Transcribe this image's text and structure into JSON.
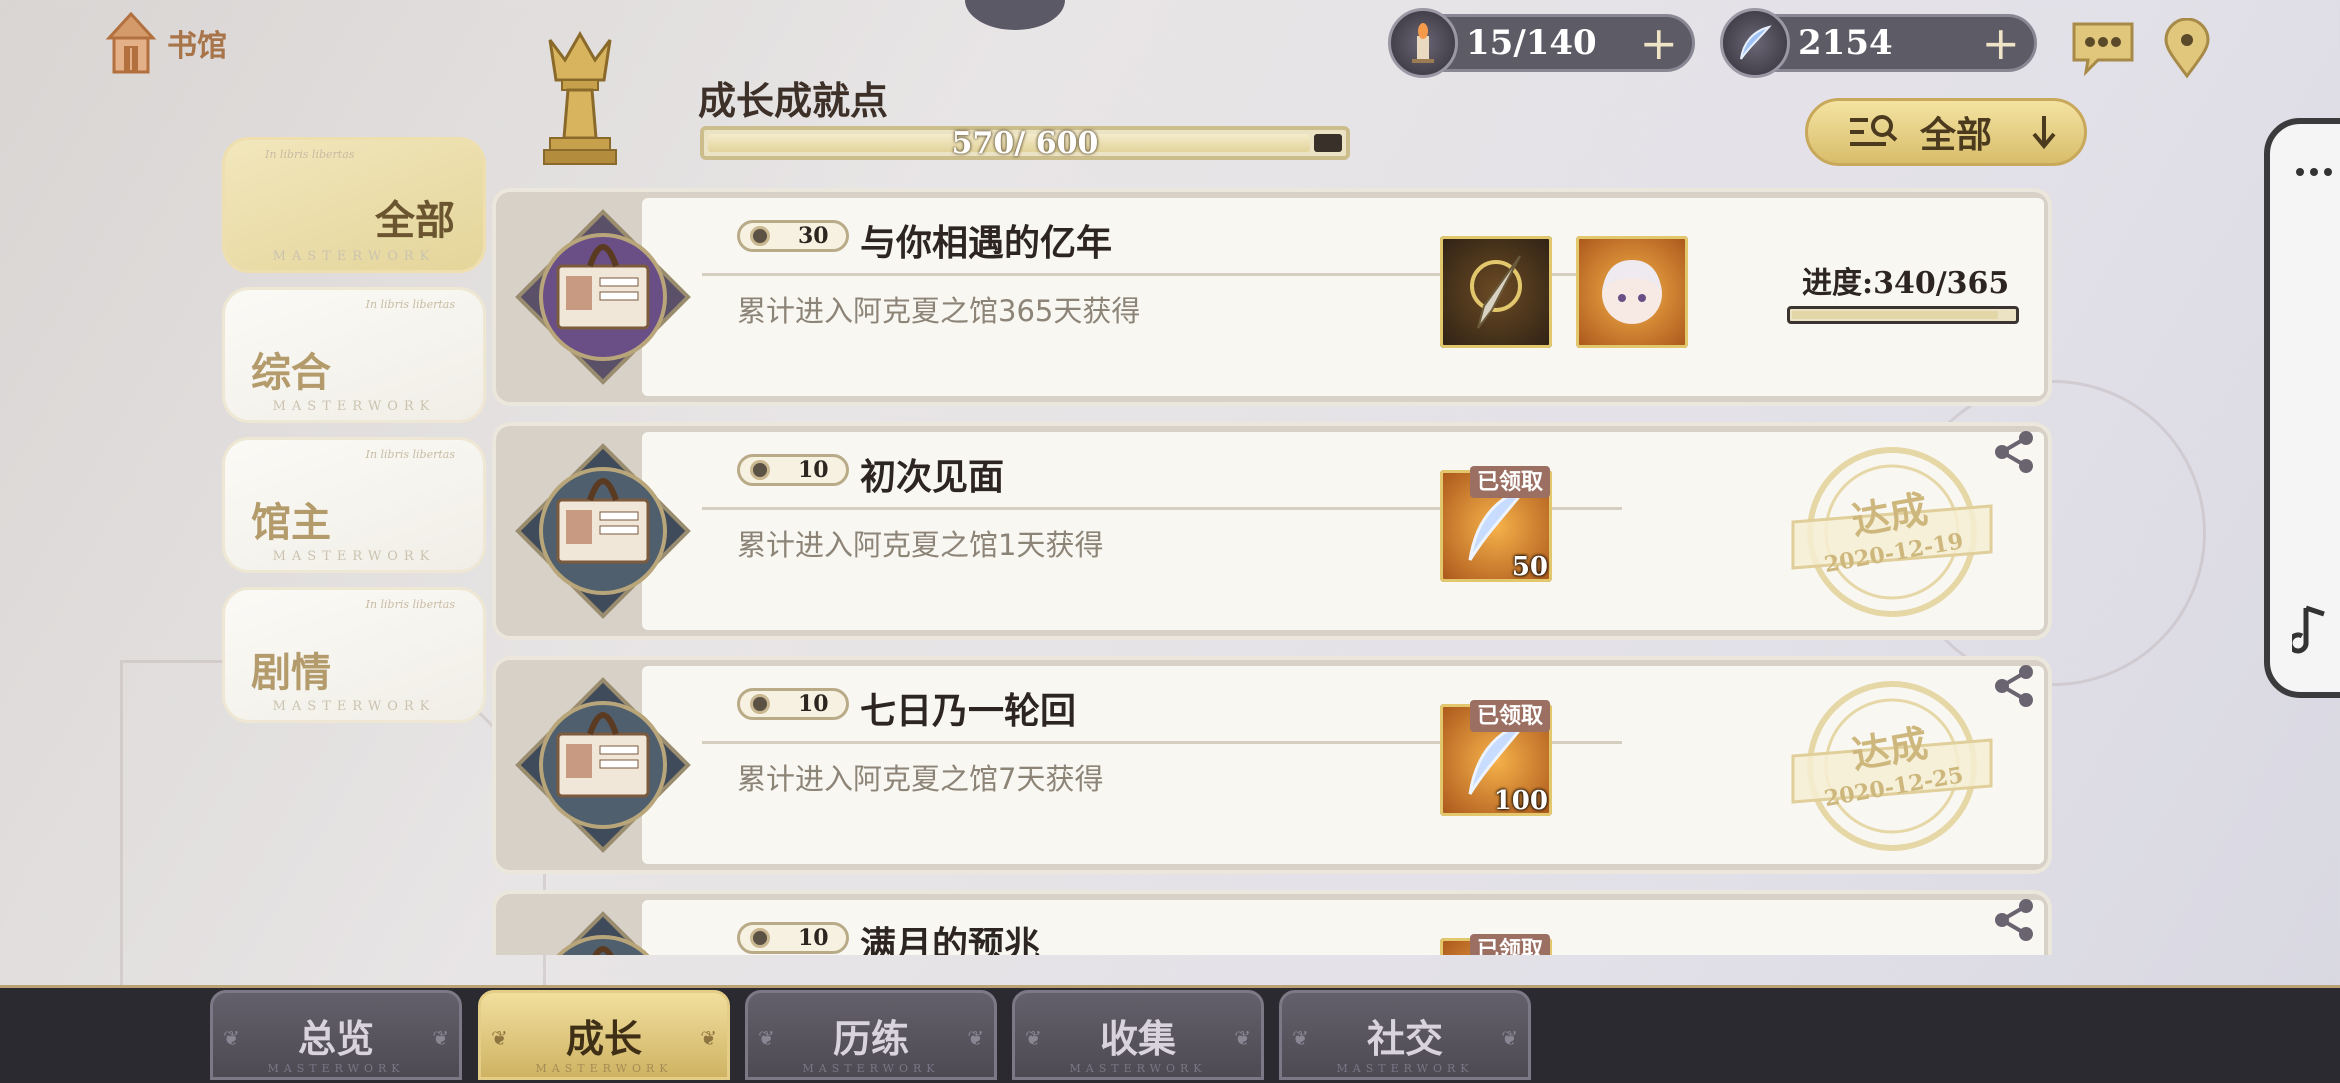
{
  "header": {
    "library_label": "书馆",
    "stamina_value": "15/140",
    "gem_value": "2154",
    "points_title": "成长成就点",
    "points_text": "570/ 600",
    "points_progress": 0.95,
    "filter_label": "全部"
  },
  "side_tabs": [
    {
      "label": "全部",
      "tiny": "In libris libertas",
      "mw": "MASTERWORK"
    },
    {
      "label": "综合",
      "tiny": "In libris libertas",
      "mw": "MASTERWORK"
    },
    {
      "label": "馆主",
      "tiny": "In libris libertas",
      "mw": "MASTERWORK"
    },
    {
      "label": "剧情",
      "tiny": "In libris libertas",
      "mw": "MASTERWORK"
    }
  ],
  "achievements": [
    {
      "points": "30",
      "title": "与你相遇的亿年",
      "desc": "累计进入阿克夏之馆365天获得",
      "progress_label": "进度:340/365",
      "progress": 0.93
    },
    {
      "points": "10",
      "title": "初次见面",
      "desc": "累计进入阿克夏之馆1天获得",
      "claimed": "已领取",
      "qty": "50",
      "stamp_text": "达成",
      "stamp_date": "2020-12-19"
    },
    {
      "points": "10",
      "title": "七日乃一轮回",
      "desc": "累计进入阿克夏之馆7天获得",
      "claimed": "已领取",
      "qty": "100",
      "stamp_text": "达成",
      "stamp_date": "2020-12-25"
    },
    {
      "points": "10",
      "title": "满月的预兆",
      "claimed": "已领取"
    }
  ],
  "bottom_tabs": [
    {
      "label": "总览",
      "mw": "MASTERWORK"
    },
    {
      "label": "成长",
      "mw": "MASTERWORK"
    },
    {
      "label": "历练",
      "mw": "MASTERWORK"
    },
    {
      "label": "收集",
      "mw": "MASTERWORK"
    },
    {
      "label": "社交",
      "mw": "MASTERWORK"
    }
  ],
  "colors": {
    "gold": "#d8bd6b",
    "nav_bg": "#2c2a31",
    "card_bg": "#f9f7f2"
  }
}
